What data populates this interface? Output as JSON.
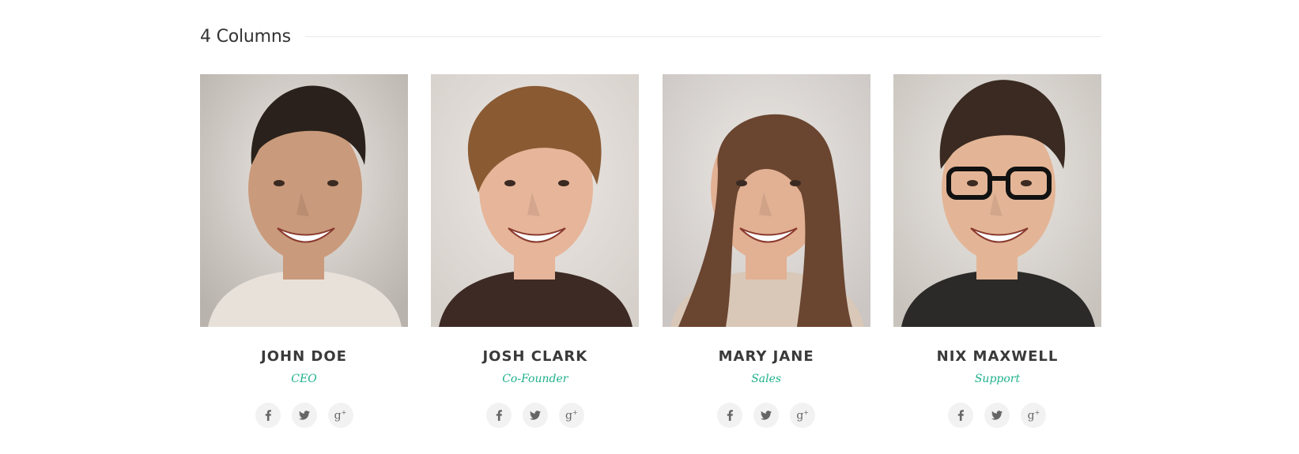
{
  "section": {
    "title": "4 Columns"
  },
  "team": [
    {
      "name": "JOHN DOE",
      "role": "CEO",
      "photo": {
        "bg": "#b9b3ad",
        "skin": "#c99a7b",
        "hair": "#2a211c",
        "shirt": "#e7e1da",
        "style": "short",
        "glasses": false
      }
    },
    {
      "name": "JOSH CLARK",
      "role": "Co-Founder",
      "photo": {
        "bg": "#d6d0cb",
        "skin": "#e6b59a",
        "hair": "#8a5a33",
        "shirt": "#3d2a24",
        "style": "messy",
        "glasses": false
      }
    },
    {
      "name": "MARY JANE",
      "role": "Sales",
      "photo": {
        "bg": "#cbc6c3",
        "skin": "#e2b093",
        "hair": "#6a4530",
        "shirt": "#d9c8b8",
        "style": "long",
        "glasses": false
      }
    },
    {
      "name": "NIX MAXWELL",
      "role": "Support",
      "photo": {
        "bg": "#c8c3bd",
        "skin": "#e3b596",
        "hair": "#3a2a22",
        "shirt": "#2b2a28",
        "style": "quiff",
        "glasses": true
      }
    }
  ],
  "social_icons": [
    "facebook-icon",
    "twitter-icon",
    "google-plus-icon"
  ],
  "colors": {
    "accent": "#1fb18b",
    "name_text": "#3a3a3a",
    "icon_bg": "#f2f2f2"
  }
}
